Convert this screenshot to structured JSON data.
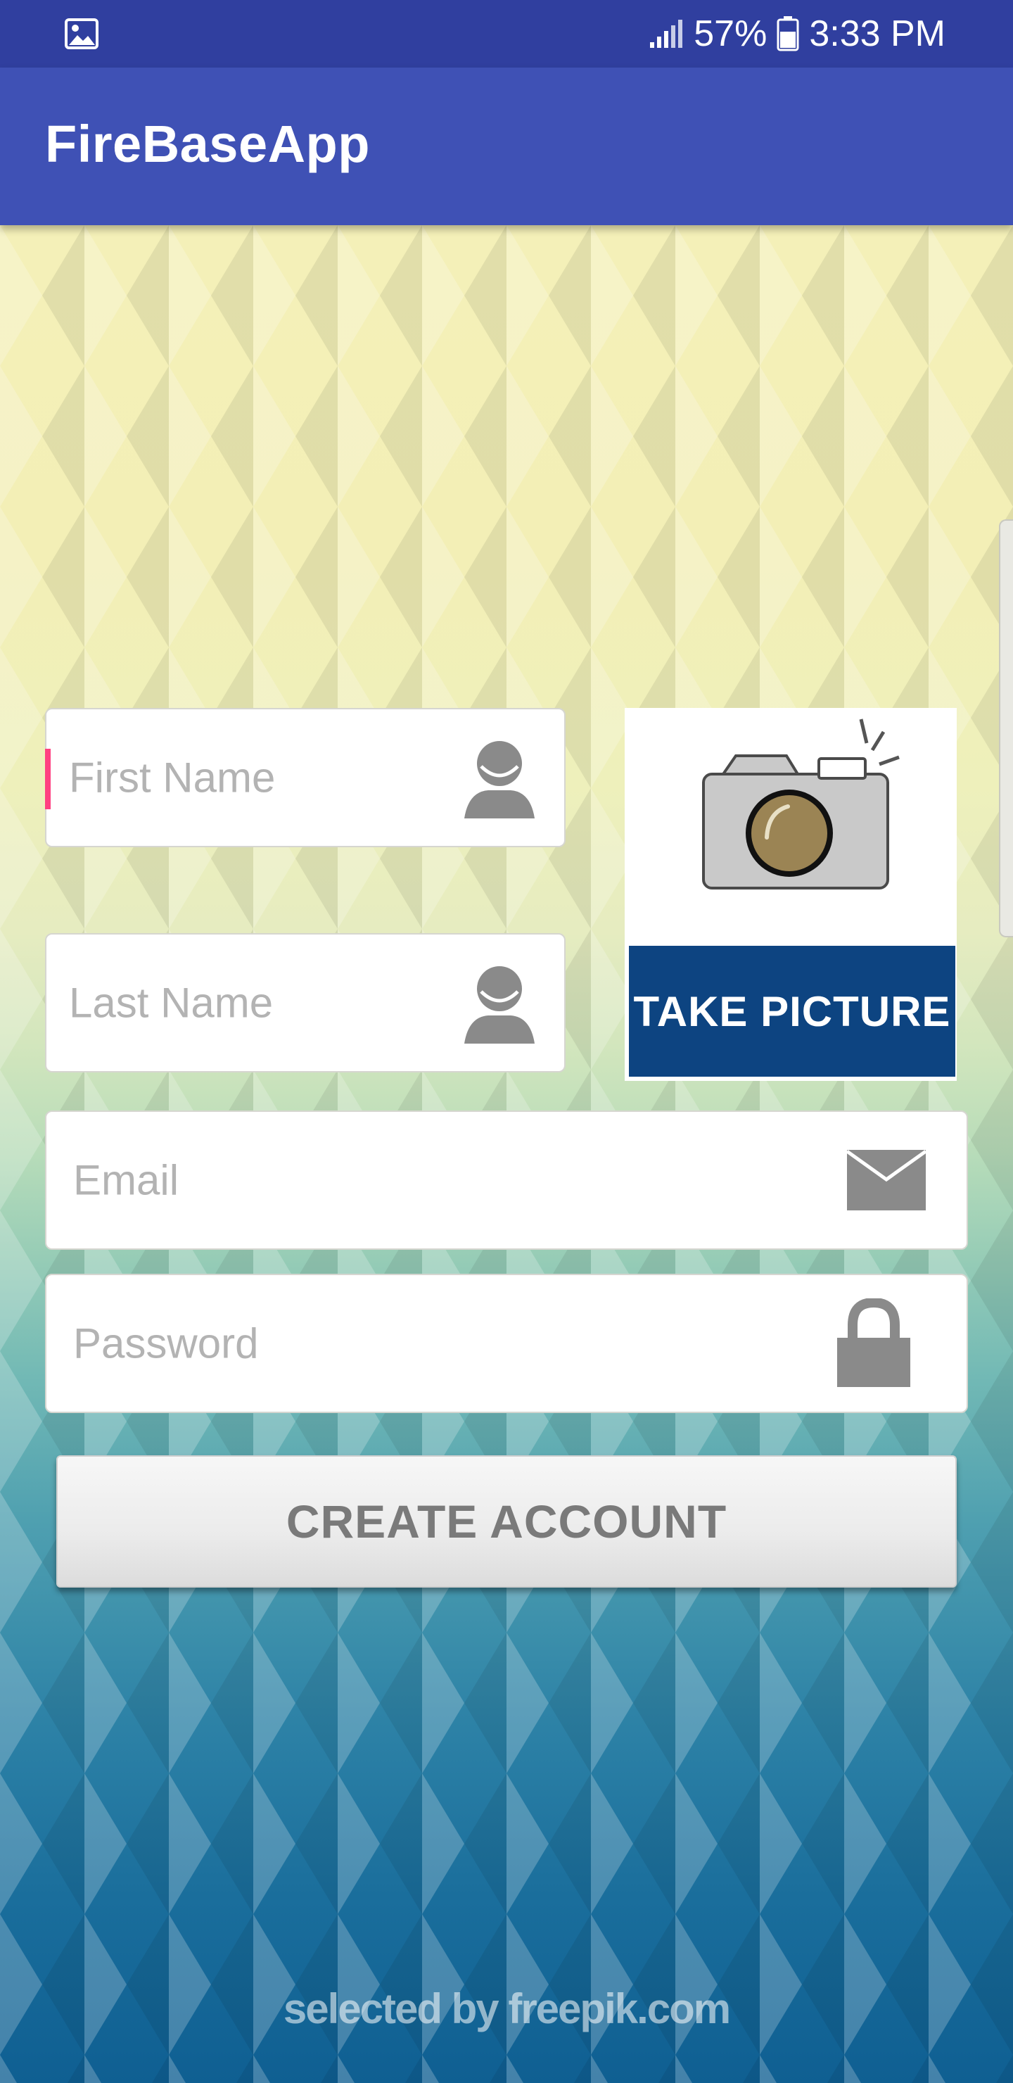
{
  "status_bar": {
    "battery_percent": "57%",
    "time": "3:33 PM",
    "icons": [
      "gallery-icon",
      "signal-icon",
      "battery-icon"
    ]
  },
  "app_bar": {
    "title": "FireBaseApp"
  },
  "form": {
    "first_name": {
      "placeholder": "First Name",
      "value": "",
      "icon": "person-icon"
    },
    "last_name": {
      "placeholder": "Last Name",
      "value": "",
      "icon": "person-icon"
    },
    "email": {
      "placeholder": "Email",
      "value": "",
      "icon": "mail-icon"
    },
    "password": {
      "placeholder": "Password",
      "value": "",
      "icon": "lock-icon"
    },
    "take_picture_label": "TAKE PICTURE",
    "create_account_label": "CREATE ACCOUNT"
  },
  "background": {
    "watermark": "selected by freepik.com"
  },
  "colors": {
    "status_bar": "#303f9f",
    "app_bar": "#3f51b5",
    "cursor_accent": "#ff4081",
    "take_picture_banner": "#0d4481"
  }
}
